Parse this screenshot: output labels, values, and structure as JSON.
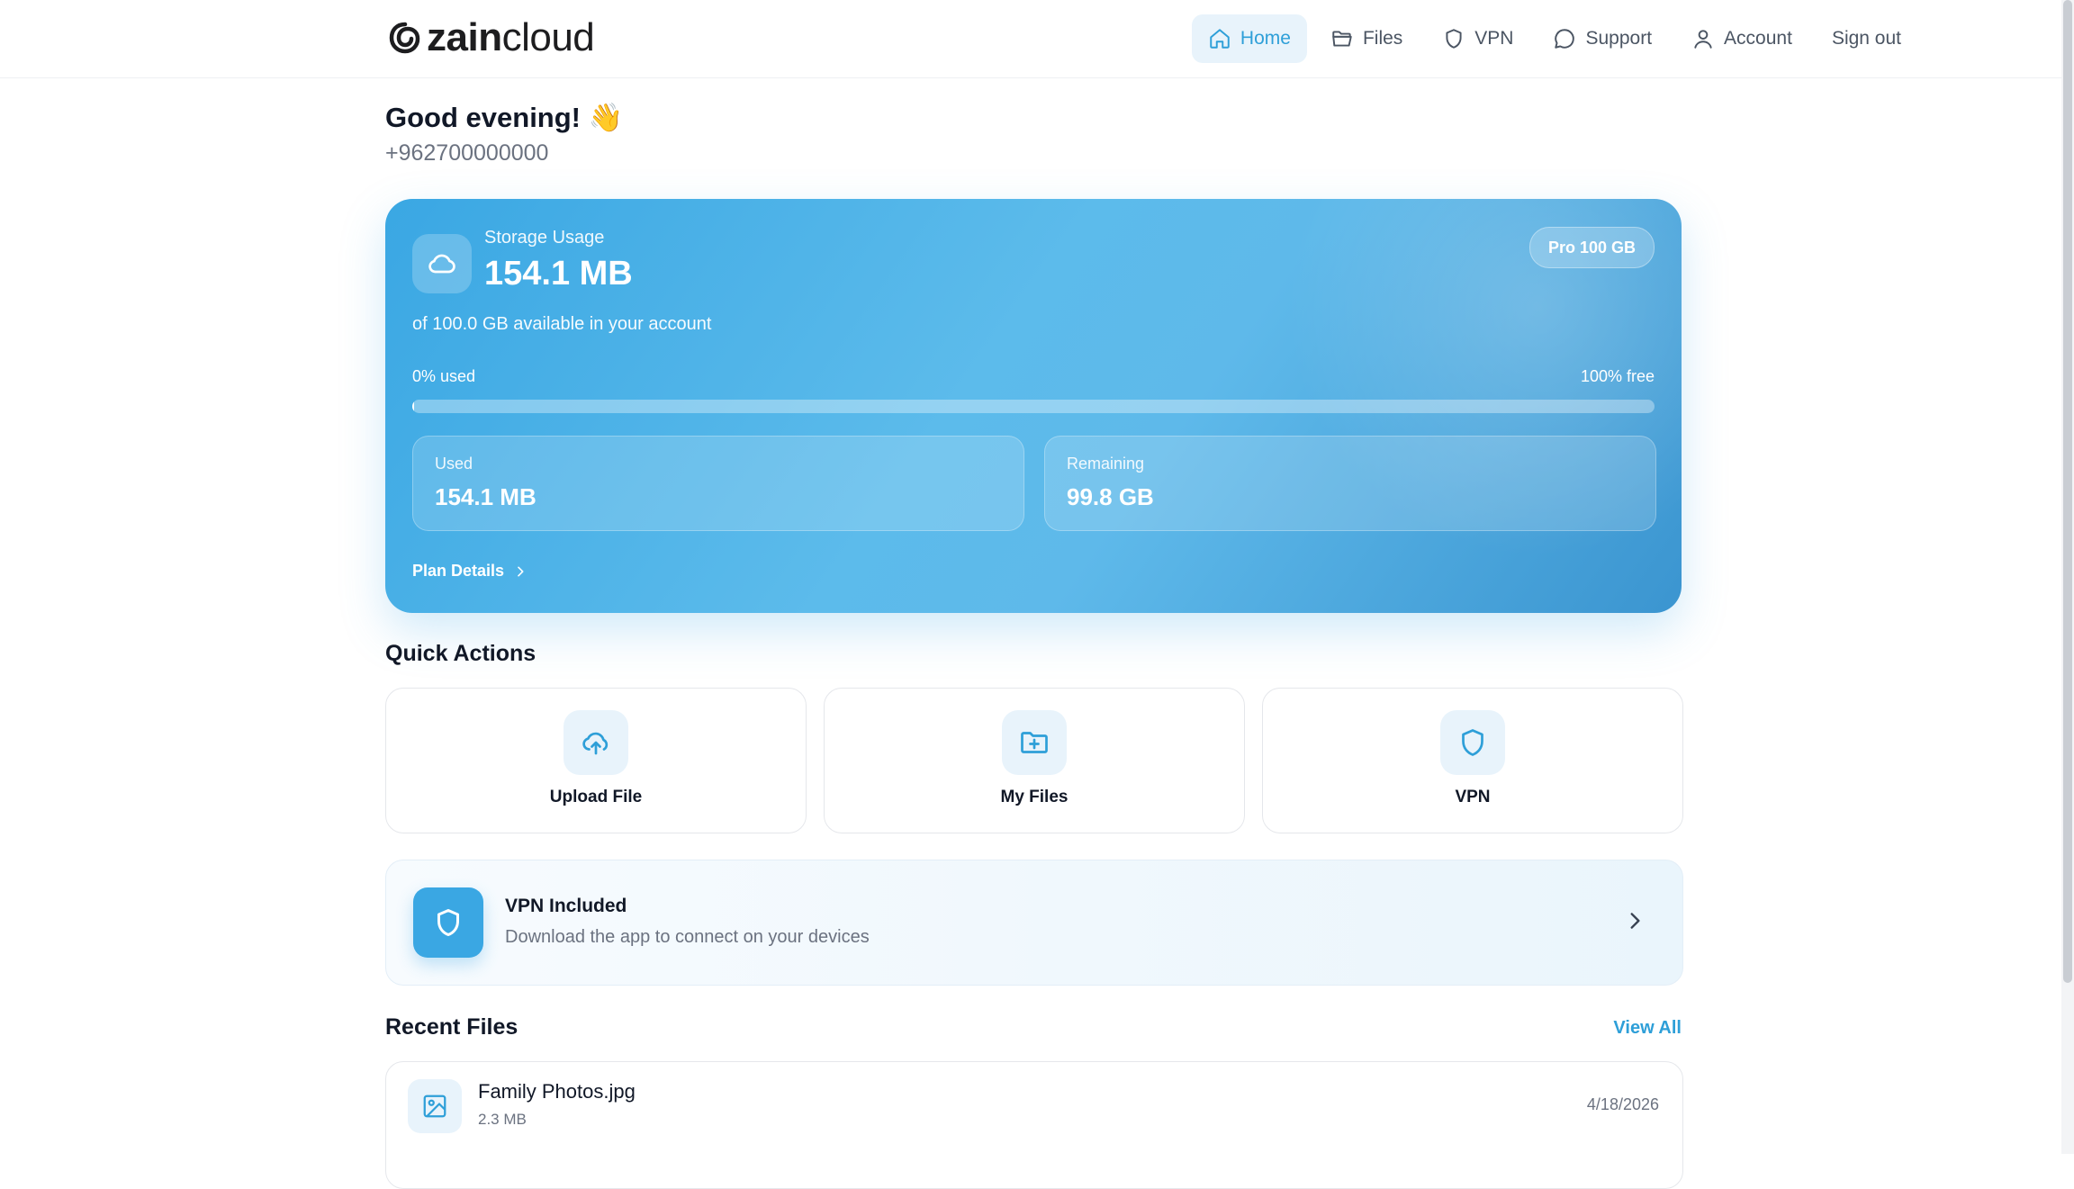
{
  "brand": {
    "logo_bold": "zain",
    "logo_light": "cloud"
  },
  "nav": {
    "items": [
      {
        "label": "Home",
        "icon": "home-icon",
        "active": true
      },
      {
        "label": "Files",
        "icon": "folder-icon"
      },
      {
        "label": "VPN",
        "icon": "shield-icon"
      },
      {
        "label": "Support",
        "icon": "chat-icon"
      },
      {
        "label": "Account",
        "icon": "user-icon"
      },
      {
        "label": "Sign out"
      }
    ]
  },
  "greeting": {
    "text": "Good evening!",
    "emoji": "👋",
    "phone": "+962700000000"
  },
  "storage": {
    "label": "Storage Usage",
    "amount": "154.1 MB",
    "available_text": "of 100.0 GB available in your account",
    "plan_badge": "Pro 100 GB",
    "used_percent_text": "0% used",
    "free_percent_text": "100% free",
    "used_fraction": 0.0015,
    "used_label": "Used",
    "used_value": "154.1 MB",
    "remaining_label": "Remaining",
    "remaining_value": "99.8 GB",
    "plan_details_label": "Plan Details"
  },
  "quick_actions": {
    "title": "Quick Actions",
    "items": [
      {
        "label": "Upload File",
        "icon": "cloud-upload-icon"
      },
      {
        "label": "My Files",
        "icon": "folder-plus-icon"
      },
      {
        "label": "VPN",
        "icon": "shield-icon"
      }
    ]
  },
  "vpn_banner": {
    "title": "VPN Included",
    "subtitle": "Download the app to connect on your devices"
  },
  "recent_files": {
    "title": "Recent Files",
    "view_all": "View All",
    "items": [
      {
        "name": "Family Photos.jpg",
        "size": "2.3 MB",
        "date": "4/18/2026",
        "icon": "image-icon"
      }
    ]
  },
  "colors": {
    "accent": "#2e9fd8",
    "card_gradient_start": "#3aa7e3",
    "card_gradient_end": "#3b95d0"
  }
}
